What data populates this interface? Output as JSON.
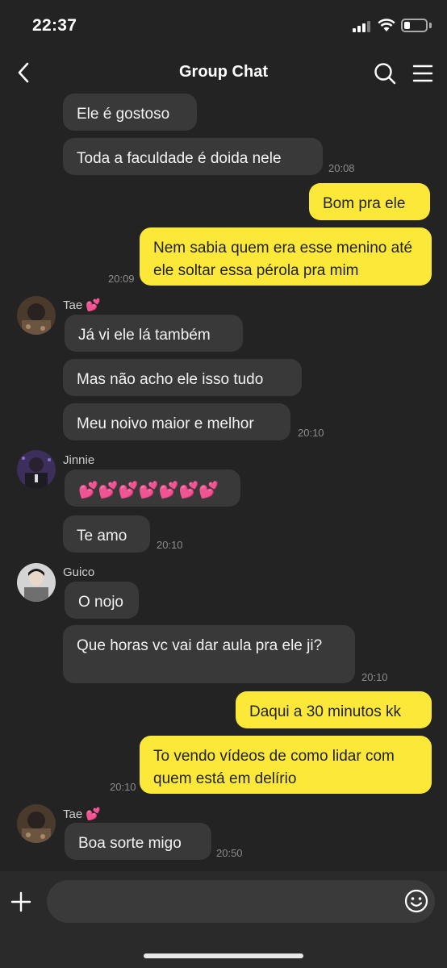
{
  "status_bar": {
    "time": "22:37"
  },
  "header": {
    "title": "Group Chat"
  },
  "messages": {
    "m1": {
      "text": "Ele é gostoso"
    },
    "m2": {
      "text": "Toda a faculdade é doida nele",
      "time": "20:08"
    },
    "m3": {
      "text": "Bom pra ele"
    },
    "m4": {
      "text": "Nem sabia quem era esse menino até ele soltar essa pérola pra mim",
      "time": "20:09"
    },
    "tae1": {
      "sender": "Tae",
      "sender_emoji": "💕"
    },
    "m5": {
      "text": "Já vi ele lá também"
    },
    "m6": {
      "text": "Mas não acho ele isso tudo"
    },
    "m7": {
      "text": "Meu noivo maior e melhor",
      "time": "20:10"
    },
    "jinnie": {
      "sender": "Jinnie"
    },
    "m8": {
      "text": "💕💕💕💕💕💕💕"
    },
    "m9": {
      "text": "Te amo",
      "time": "20:10"
    },
    "guico": {
      "sender": "Guico"
    },
    "m10": {
      "text": "O nojo"
    },
    "m11": {
      "text": "Que horas vc vai dar aula pra ele ji?",
      "time": "20:10"
    },
    "m12": {
      "text": "Daqui a 30 minutos kk"
    },
    "m13": {
      "text": "To vendo vídeos de como lidar com quem está em delírio",
      "time": "20:10"
    },
    "tae2": {
      "sender": "Tae",
      "sender_emoji": "💕"
    },
    "m14": {
      "text": "Boa sorte migo",
      "time": "20:50"
    }
  },
  "input": {
    "placeholder": ""
  },
  "colors": {
    "background": "#232323",
    "incoming_bubble": "#393939",
    "outgoing_bubble": "#fbe839",
    "heart": "#ff4fa8"
  },
  "icons": [
    "back-icon",
    "search-icon",
    "menu-icon",
    "plus-icon",
    "emoji-icon"
  ]
}
